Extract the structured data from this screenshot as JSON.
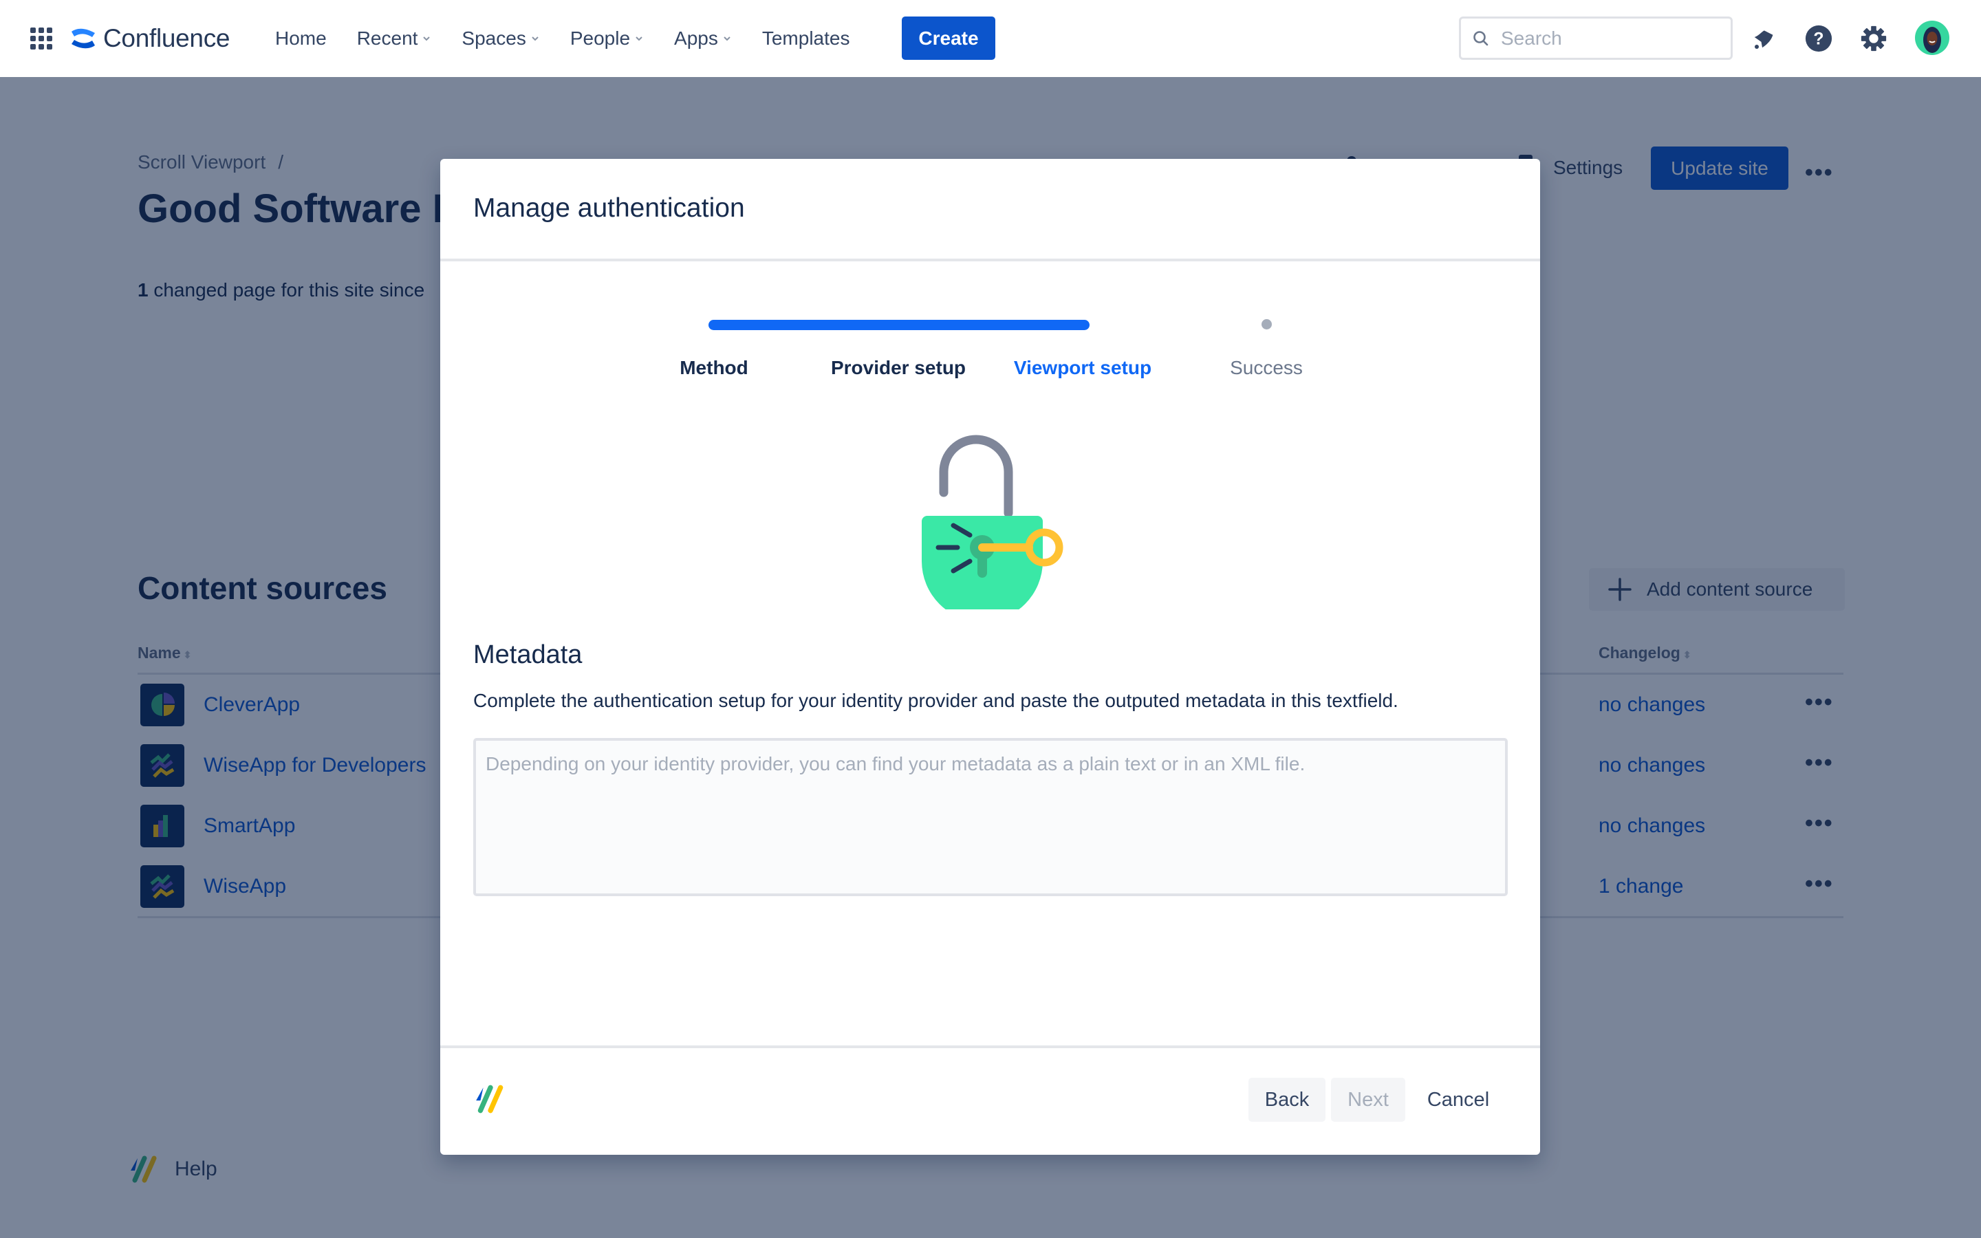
{
  "topnav": {
    "app_name": "Confluence",
    "items": [
      {
        "label": "Home",
        "dropdown": false
      },
      {
        "label": "Recent",
        "dropdown": true
      },
      {
        "label": "Spaces",
        "dropdown": true
      },
      {
        "label": "People",
        "dropdown": true
      },
      {
        "label": "Apps",
        "dropdown": true
      },
      {
        "label": "Templates",
        "dropdown": false
      }
    ],
    "create_label": "Create",
    "search_placeholder": "Search",
    "icons": [
      "app-switcher-icon",
      "notifications-icon",
      "help-icon",
      "settings-icon",
      "avatar"
    ]
  },
  "page": {
    "breadcrumb": [
      "Scroll Viewport",
      "/"
    ],
    "title": "Good Software H",
    "changed_count": "1",
    "changed_text": " changed page for this site since",
    "settings_label": "Settings",
    "update_label": "Update site",
    "more_label": "•••",
    "content_sources": {
      "title": "Content sources",
      "add_label": "Add content source",
      "columns": [
        "Name",
        "Changelog"
      ],
      "rows": [
        {
          "name": "CleverApp",
          "icon": "pie-chart-app-icon",
          "changelog": "no changes"
        },
        {
          "name": "WiseApp for Developers",
          "icon": "zigzag-app-icon",
          "changelog": "no changes"
        },
        {
          "name": "SmartApp",
          "icon": "bar-chart-app-icon",
          "changelog": "no changes"
        },
        {
          "name": "WiseApp",
          "icon": "zigzag-app-icon",
          "changelog": "1 change"
        }
      ]
    },
    "help_label": "Help"
  },
  "modal": {
    "title": "Manage authentication",
    "steps": [
      {
        "label": "Method",
        "state": "done"
      },
      {
        "label": "Provider setup",
        "state": "done"
      },
      {
        "label": "Viewport setup",
        "state": "current"
      },
      {
        "label": "Success",
        "state": "pending"
      }
    ],
    "progress_percent": 75,
    "section_heading": "Metadata",
    "section_description": "Complete the authentication setup for your identity provider and paste the outputed metadata in this textfield.",
    "textarea_value": "",
    "textarea_placeholder": "Depending on your identity provider, you can find your metadata as a plain text or in an XML file.",
    "buttons": {
      "back": "Back",
      "next": "Next",
      "cancel": "Cancel"
    },
    "next_disabled": true
  },
  "colors": {
    "brand_blue": "#0c55cc",
    "progress_blue": "#1068f5",
    "lock_green": "#3ae8a6",
    "key_yellow": "#ffc234",
    "overlay": "rgba(9,30,66,0.54)"
  }
}
